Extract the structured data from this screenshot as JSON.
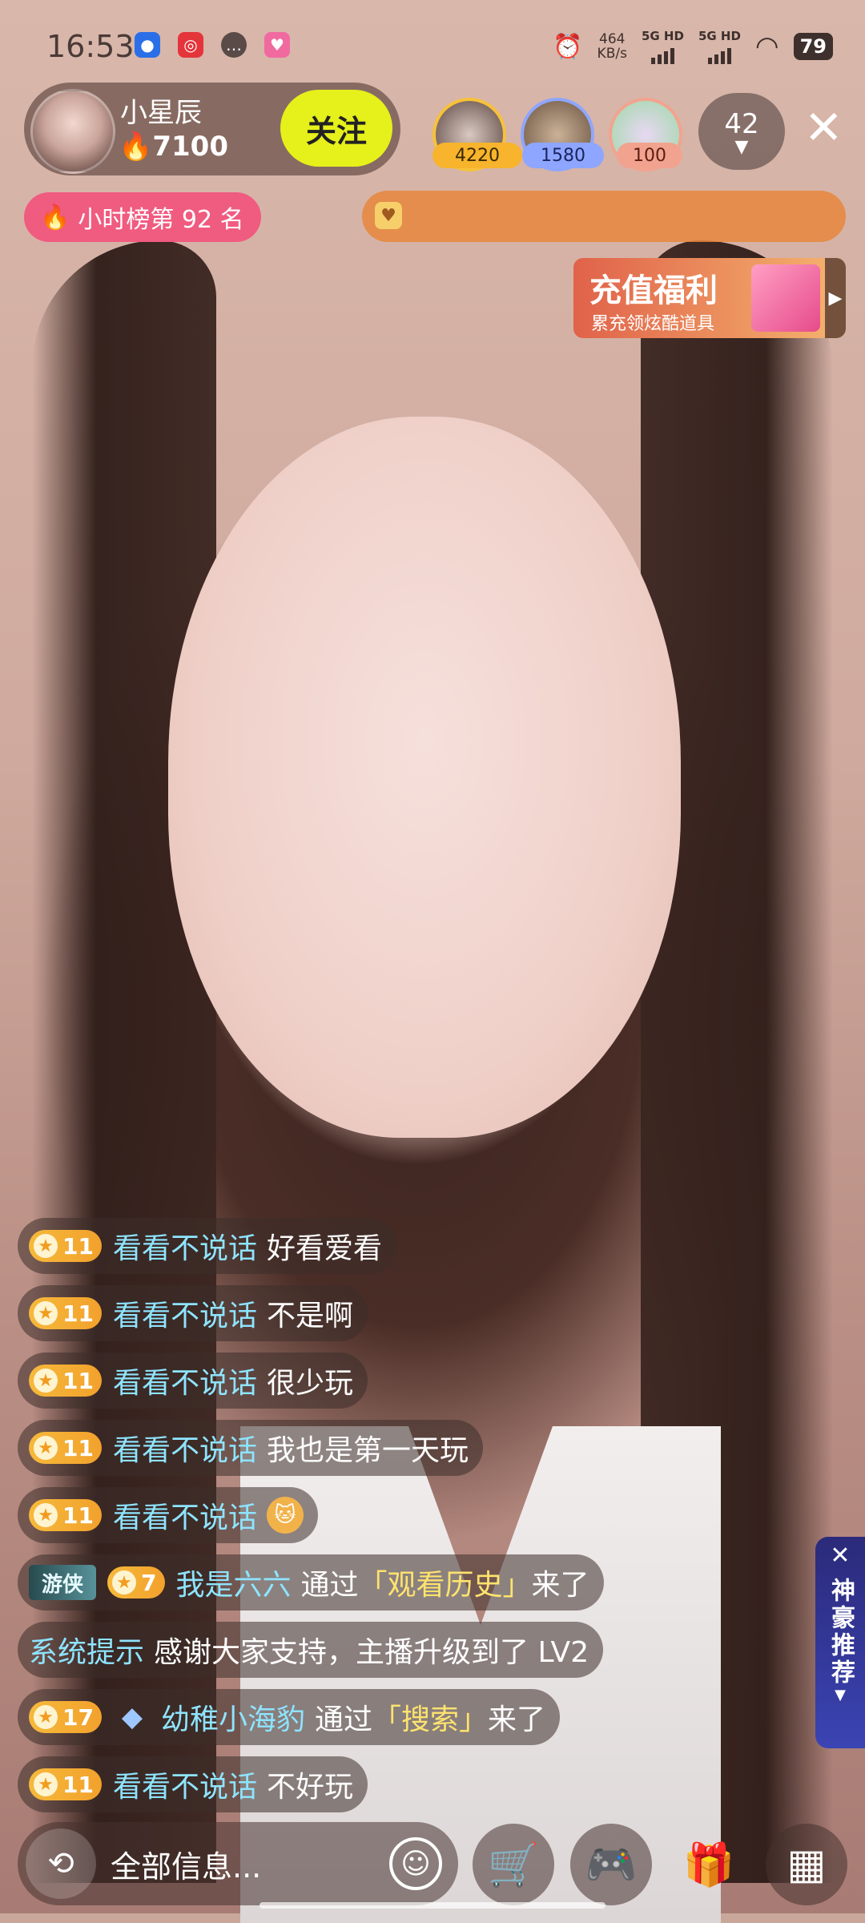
{
  "status_bar": {
    "time": "16:53",
    "net_speed_value": "464",
    "net_speed_unit": "KB/s",
    "sim1": "5G HD",
    "sim2": "5G HD",
    "battery": "79"
  },
  "host": {
    "name": "小星辰",
    "score": "7100",
    "follow_label": "关注"
  },
  "top_viewers": [
    {
      "score": "4220",
      "badge_color": "#f7b42c"
    },
    {
      "score": "1580",
      "badge_color": "#8ea6ff"
    },
    {
      "score": "100",
      "badge_color": "#f2a38f"
    }
  ],
  "viewer_count": "42",
  "rank_badge": "小时榜第 92 名",
  "promo": {
    "title": "充值福利",
    "subtitle": "累充领炫酷道具"
  },
  "chat": [
    {
      "level": "11",
      "user": "看看不说话",
      "text": "好看爱看"
    },
    {
      "level": "11",
      "user": "看看不说话",
      "text": "不是啊"
    },
    {
      "level": "11",
      "user": "看看不说话",
      "text": "很少玩"
    },
    {
      "level": "11",
      "user": "看看不说话",
      "text": "我也是第一天玩"
    },
    {
      "level": "11",
      "user": "看看不说话",
      "text": ""
    },
    {
      "rank_tag": "游侠",
      "level": "7",
      "user": "我是六六",
      "pre": "通过",
      "source": "「观看历史」",
      "post": "来了"
    },
    {
      "system_label": "系统提示",
      "text": "感谢大家支持，主播升级到了 LV2"
    },
    {
      "level": "17",
      "user": "幼稚小海豹",
      "pre": "通过",
      "source": "「搜索」",
      "post": "来了"
    },
    {
      "level": "11",
      "user": "看看不说话",
      "text": "不好玩"
    }
  ],
  "side_panel": {
    "label": "神豪推荐"
  },
  "bottom": {
    "input_placeholder": "全部信息..."
  },
  "icons": {
    "refresh": "refresh-icon",
    "emoji": "emoji-icon",
    "cart": "shopping-cart-icon",
    "game": "gamepad-icon",
    "gift": "gift-icon",
    "more": "grid-menu-icon"
  }
}
